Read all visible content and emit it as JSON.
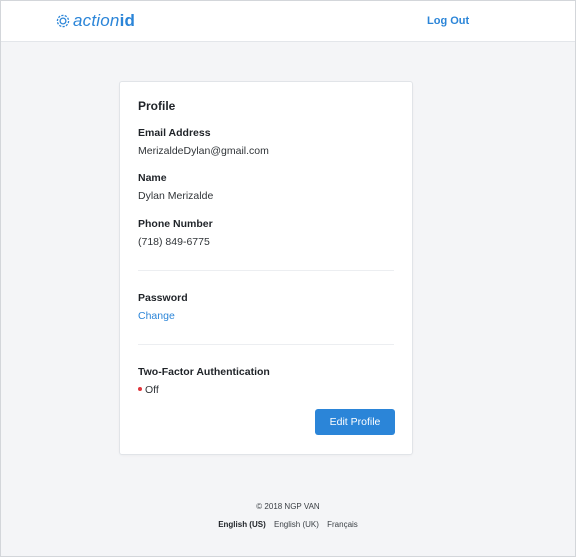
{
  "header": {
    "logo_prefix": "action",
    "logo_suffix": "id",
    "logout_label": "Log Out"
  },
  "profile": {
    "title": "Profile",
    "email_label": "Email Address",
    "email_value": "MerizaldeDylan@gmail.com",
    "name_label": "Name",
    "name_value": "Dylan Merizalde",
    "phone_label": "Phone Number",
    "phone_value": "(718) 849-6775",
    "password_label": "Password",
    "password_change": "Change",
    "twofa_label": "Two-Factor Authentication",
    "twofa_status": "Off",
    "edit_button": "Edit Profile"
  },
  "footer": {
    "copyright": "© 2018 NGP VAN",
    "languages": [
      "English (US)",
      "English (UK)",
      "Français"
    ],
    "active_language": "English (US)"
  },
  "colors": {
    "accent": "#2b85d8",
    "status_off": "#e0353c",
    "background": "#f4f5f7"
  }
}
